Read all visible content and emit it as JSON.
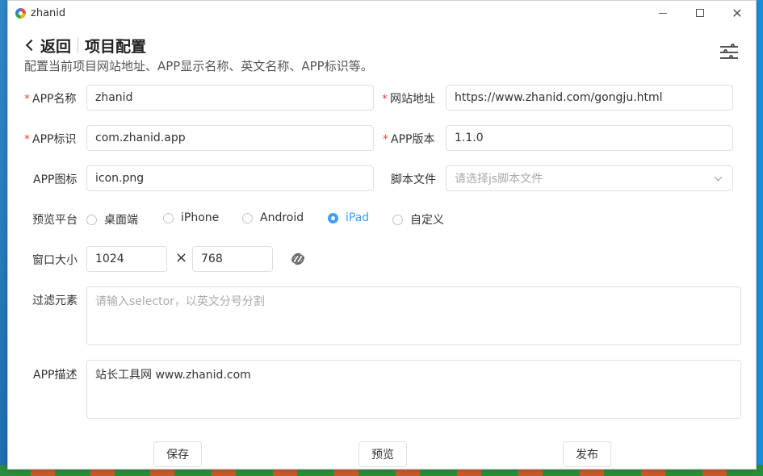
{
  "window": {
    "title": "zhanid"
  },
  "header": {
    "back_label": "返回",
    "title": "项目配置",
    "subtitle": "配置当前项目网站地址、APP显示名称、英文名称、APP标识等。"
  },
  "form": {
    "app_name": {
      "label": "APP名称",
      "required": true,
      "value": "zhanid"
    },
    "website": {
      "label": "网站地址",
      "required": true,
      "value": "https://www.zhanid.com/gongju.html"
    },
    "app_id": {
      "label": "APP标识",
      "required": true,
      "value": "com.zhanid.app"
    },
    "app_version": {
      "label": "APP版本",
      "required": true,
      "value": "1.1.0"
    },
    "app_icon": {
      "label": "APP图标",
      "value": "icon.png"
    },
    "script_file": {
      "label": "脚本文件",
      "placeholder": "请选择js脚本文件"
    },
    "preview_platform": {
      "label": "预览平台",
      "options": [
        "桌面端",
        "iPhone",
        "Android",
        "iPad",
        "自定义"
      ],
      "selected": "iPad"
    },
    "window_size": {
      "label": "窗口大小",
      "width": "1024",
      "height": "768",
      "times": "×"
    },
    "filter": {
      "label": "过滤元素",
      "placeholder": "请输入selector，以英文分号分割"
    },
    "description": {
      "label": "APP描述",
      "value": "站长工具网 www.zhanid.com"
    }
  },
  "actions": {
    "save": "保存",
    "preview": "预览",
    "publish": "发布"
  },
  "colors": {
    "accent": "#409eff",
    "required": "#e5484d"
  }
}
